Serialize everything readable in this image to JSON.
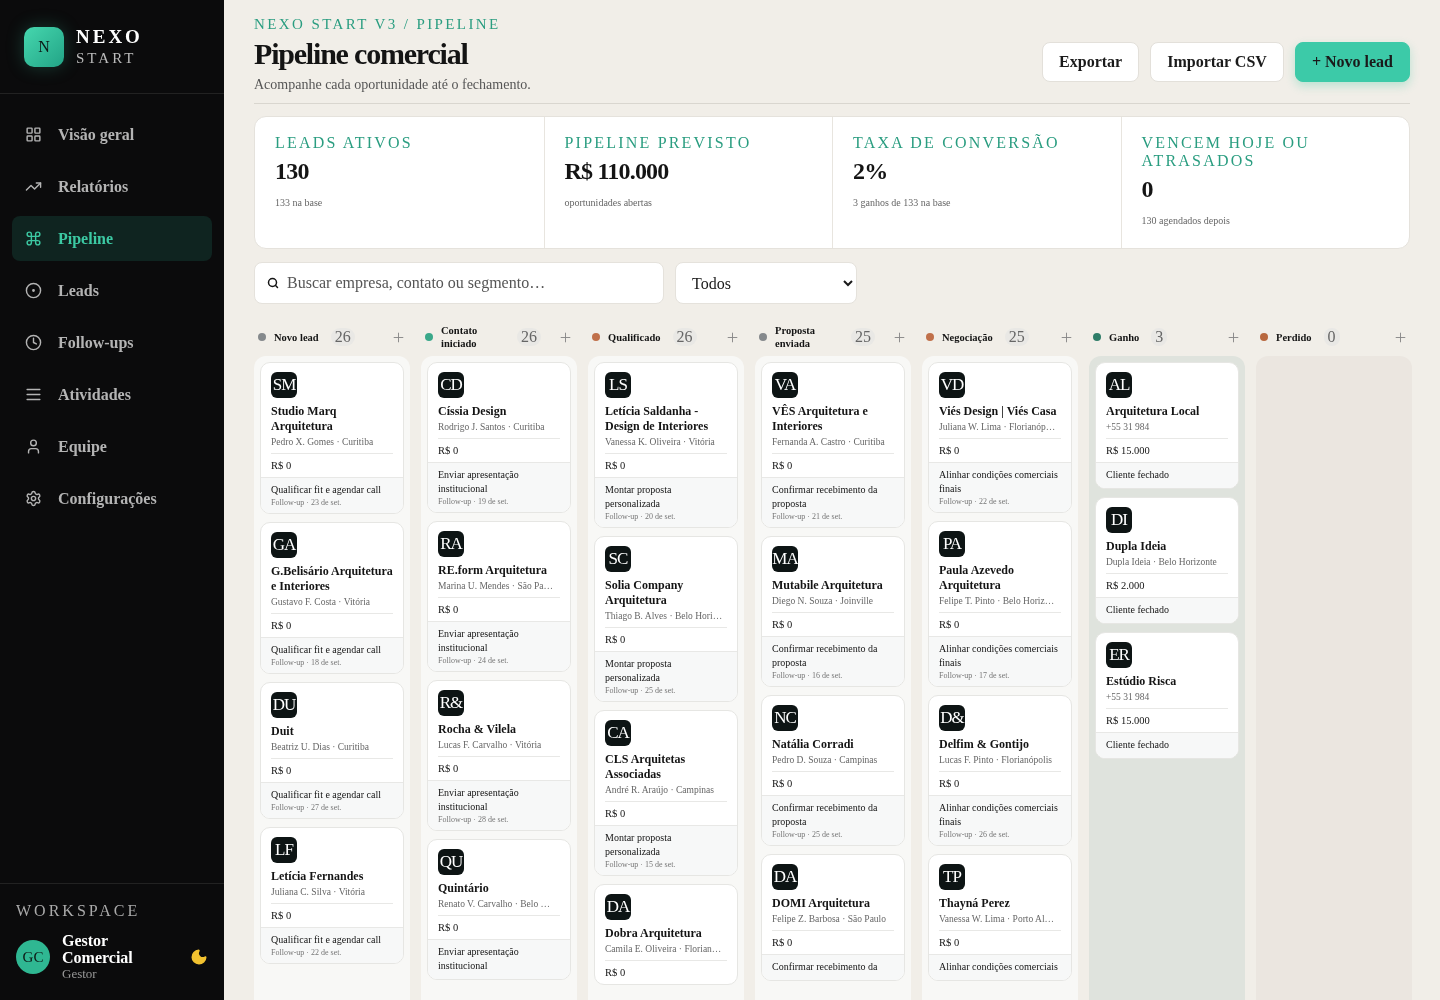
{
  "brand": {
    "mark": "N",
    "name": "NEXO",
    "sub": "START"
  },
  "nav": [
    {
      "label": "Visão geral",
      "selected": false
    },
    {
      "label": "Relatórios",
      "selected": false
    },
    {
      "label": "Pipeline",
      "selected": true
    },
    {
      "label": "Leads",
      "selected": false
    },
    {
      "label": "Follow-ups",
      "selected": false
    },
    {
      "label": "Atividades",
      "selected": false
    },
    {
      "label": "Equipe",
      "selected": false
    },
    {
      "label": "Configurações",
      "selected": false
    }
  ],
  "workspace": {
    "label": "WORKSPACE",
    "initials": "GC",
    "name": "Gestor Comercial",
    "role": "Gestor"
  },
  "header": {
    "breadcrumb": "NEXO START V3 / PIPELINE",
    "title": "Pipeline comercial",
    "subtitle": "Acompanhe cada oportunidade até o fechamento.",
    "buttons": [
      {
        "label": "Exportar",
        "kind": "plain"
      },
      {
        "label": "Importar CSV",
        "kind": "plain"
      },
      {
        "label": "+ Novo lead",
        "kind": "primary"
      }
    ]
  },
  "stats": [
    {
      "label": "LEADS ATIVOS",
      "value": "130",
      "note": "133 na base"
    },
    {
      "label": "PIPELINE PREVISTO",
      "value": "R$ 110.000",
      "note": "oportunidades abertas"
    },
    {
      "label": "TAXA DE CONVERSÃO",
      "value": "2%",
      "note": "3 ganhos de 133 na base"
    },
    {
      "label": "VENCEM HOJE OU ATRASADOS",
      "value": "0",
      "note": "130 agendados depois"
    }
  ],
  "search": {
    "placeholder": "Buscar empresa, contato ou segmento…"
  },
  "filter": {
    "value": "Todos"
  },
  "columns": [
    {
      "title": "Novo lead",
      "count": "26",
      "color": "#85898c",
      "kind": "open",
      "cards": [
        {
          "initials": "SM",
          "name": "Studio Marq Arquitetura",
          "contact": "Pedro X. Gomes · Curitiba",
          "value": "R$ 0",
          "task": "Qualificar fit e agendar call",
          "followup": "Follow-up · 23 de set."
        },
        {
          "initials": "GA",
          "name": "G.Belisário Arquitetura e Interiores",
          "contact": "Gustavo F. Costa · Vitória",
          "value": "R$ 0",
          "task": "Qualificar fit e agendar call",
          "followup": "Follow-up · 18 de set."
        },
        {
          "initials": "DU",
          "name": "Duit",
          "contact": "Beatriz U. Dias · Curitiba",
          "value": "R$ 0",
          "task": "Qualificar fit e agendar call",
          "followup": "Follow-up · 27 de set."
        },
        {
          "initials": "LF",
          "name": "Letícia Fernandes",
          "contact": "Juliana C. Silva · Vitória",
          "value": "R$ 0",
          "task": "Qualificar fit e agendar call",
          "followup": "Follow-up · 22 de set."
        }
      ]
    },
    {
      "title": "Contato iniciado",
      "count": "26",
      "color": "#3aa88a",
      "kind": "open",
      "cards": [
        {
          "initials": "CD",
          "name": "Císsia Design",
          "contact": "Rodrigo J. Santos · Curitiba",
          "value": "R$ 0",
          "task": "Enviar apresentação institucional",
          "followup": "Follow-up · 19 de set."
        },
        {
          "initials": "RA",
          "name": "RE.form Arquitetura",
          "contact": "Marina U. Mendes · São Pa…",
          "value": "R$ 0",
          "task": "Enviar apresentação institucional",
          "followup": "Follow-up · 24 de set."
        },
        {
          "initials": "R&",
          "name": "Rocha & Vilela",
          "contact": "Lucas F. Carvalho · Vitória",
          "value": "R$ 0",
          "task": "Enviar apresentação institucional",
          "followup": "Follow-up · 28 de set."
        },
        {
          "initials": "QU",
          "name": "Quintário",
          "contact": "Renato V. Carvalho · Belo …",
          "value": "R$ 0",
          "task": "Enviar apresentação institucional"
        }
      ]
    },
    {
      "title": "Qualificado",
      "count": "26",
      "color": "#c0704a",
      "kind": "open",
      "cards": [
        {
          "initials": "LS",
          "name": "Letícia Saldanha - Design de Interiores",
          "contact": "Vanessa K. Oliveira · Vitória",
          "value": "R$ 0",
          "task": "Montar proposta personalizada",
          "followup": "Follow-up · 20 de set."
        },
        {
          "initials": "SC",
          "name": "Solia Company Arquitetura",
          "contact": "Thiago B. Alves · Belo Hori…",
          "value": "R$ 0",
          "task": "Montar proposta personalizada",
          "followup": "Follow-up · 25 de set."
        },
        {
          "initials": "CA",
          "name": "CLS Arquitetas Associadas",
          "contact": "André R. Araújo · Campinas",
          "value": "R$ 0",
          "task": "Montar proposta personalizada",
          "followup": "Follow-up · 15 de set."
        },
        {
          "initials": "DA",
          "name": "Dobra Arquitetura",
          "contact": "Camila E. Oliveira · Florian…",
          "value": "R$ 0"
        }
      ]
    },
    {
      "title": "Proposta enviada",
      "count": "25",
      "color": "#85898c",
      "kind": "open",
      "cards": [
        {
          "initials": "VA",
          "name": "VÊS Arquitetura e Interiores",
          "contact": "Fernanda A. Castro · Curitiba",
          "value": "R$ 0",
          "task": "Confirmar recebimento da proposta",
          "followup": "Follow-up · 21 de set."
        },
        {
          "initials": "MA",
          "name": "Mutabile Arquitetura",
          "contact": "Diego N. Souza · Joinville",
          "value": "R$ 0",
          "task": "Confirmar recebimento da proposta",
          "followup": "Follow-up · 16 de set."
        },
        {
          "initials": "NC",
          "name": "Natália Corradi",
          "contact": "Pedro D. Souza · Campinas",
          "value": "R$ 0",
          "task": "Confirmar recebimento da proposta",
          "followup": "Follow-up · 25 de set."
        },
        {
          "initials": "DA",
          "name": "DOMI Arquitetura",
          "contact": "Felipe Z. Barbosa · São Paulo",
          "value": "R$ 0",
          "task": "Confirmar recebimento da"
        }
      ]
    },
    {
      "title": "Negociação",
      "count": "25",
      "color": "#c0704a",
      "kind": "open",
      "cards": [
        {
          "initials": "VD",
          "name": "Viés Design | Viés Casa",
          "contact": "Juliana W. Lima · Florianóp…",
          "value": "R$ 0",
          "task": "Alinhar condições comerciais finais",
          "followup": "Follow-up · 22 de set."
        },
        {
          "initials": "PA",
          "name": "Paula Azevedo Arquitetura",
          "contact": "Felipe T. Pinto · Belo Horiz…",
          "value": "R$ 0",
          "task": "Alinhar condições comerciais finais",
          "followup": "Follow-up · 17 de set."
        },
        {
          "initials": "D&",
          "name": "Delfim & Gontijo",
          "contact": "Lucas F. Pinto · Florianópolis",
          "value": "R$ 0",
          "task": "Alinhar condições comerciais finais",
          "followup": "Follow-up · 26 de set."
        },
        {
          "initials": "TP",
          "name": "Thayná Perez",
          "contact": "Vanessa W. Lima · Porto Al…",
          "value": "R$ 0",
          "task": "Alinhar condições comerciais"
        }
      ]
    },
    {
      "title": "Ganho",
      "count": "3",
      "color": "#2f7d68",
      "kind": "won",
      "cards": [
        {
          "initials": "AL",
          "name": "Arquitetura Local",
          "contact": "+55 31 984",
          "value": "R$ 15.000",
          "task": "Cliente fechado"
        },
        {
          "initials": "DI",
          "name": "Dupla Ideia",
          "contact": "Dupla Ideia · Belo Horizonte",
          "value": "R$ 2.000",
          "task": "Cliente fechado"
        },
        {
          "initials": "ER",
          "name": "Estúdio Risca",
          "contact": "+55 31 984",
          "value": "R$ 15.000",
          "task": "Cliente fechado"
        }
      ]
    },
    {
      "title": "Perdido",
      "count": "0",
      "color": "#b8683f",
      "kind": "lost"
    }
  ]
}
